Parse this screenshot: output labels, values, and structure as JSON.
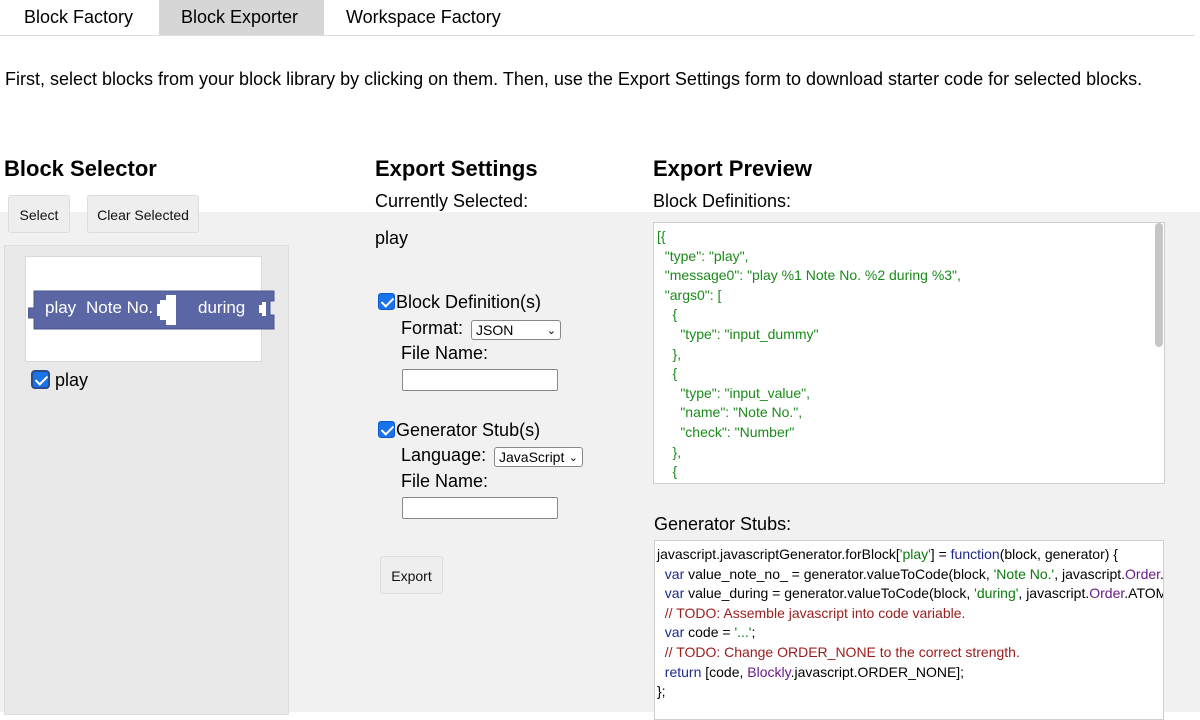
{
  "tabs": [
    "Block Factory",
    "Block Exporter",
    "Workspace Factory"
  ],
  "active_tab": "Block Exporter",
  "intro_text": "First, select blocks from your block library by clicking on them. Then, use the Export Settings form to download starter code for selected blocks.",
  "selector": {
    "title": "Block Selector",
    "select_button": "Select",
    "clear_button": "Clear Selected",
    "block": {
      "label_1": "play",
      "label_2": "Note No.",
      "label_3": "during",
      "color": "#5b67a5"
    },
    "item_label": "play",
    "item_checked": true
  },
  "export_settings": {
    "title": "Export Settings",
    "currently_selected_label": "Currently Selected:",
    "currently_selected_value": "play",
    "block_definitions": {
      "label": "Block Definition(s)",
      "checked": true,
      "format_label": "Format:",
      "format_value": "JSON",
      "file_name_label": "File Name:",
      "file_name_value": ""
    },
    "generator_stubs": {
      "label": "Generator Stub(s)",
      "checked": true,
      "language_label": "Language:",
      "language_value": "JavaScript",
      "file_name_label": "File Name:",
      "file_name_value": ""
    },
    "export_button": "Export"
  },
  "export_preview": {
    "title": "Export Preview",
    "block_definitions_label": "Block Definitions:",
    "block_definitions_lines": [
      "[{",
      "  \"type\": \"play\",",
      "  \"message0\": \"play %1 Note No. %2 during %3\",",
      "  \"args0\": [",
      "    {",
      "      \"type\": \"input_dummy\"",
      "    },",
      "    {",
      "      \"type\": \"input_value\",",
      "      \"name\": \"Note No.\",",
      "      \"check\": \"Number\"",
      "    },",
      "    {"
    ],
    "generator_stubs_label": "Generator Stubs:",
    "generator_stub_lines": [
      "javascript.javascriptGenerator.forBlock['play'] = function(block, generator) {",
      "  var value_note_no_ = generator.valueToCode(block, 'Note No.', javascript.Order.ATOMIC);",
      "  var value_during = generator.valueToCode(block, 'during', javascript.Order.ATOMIC);",
      "  // TODO: Assemble javascript into code variable.",
      "  var code = '...';",
      "  // TODO: Change ORDER_NONE to the correct strength.",
      "  return [code, Blockly.javascript.ORDER_NONE];",
      "};"
    ]
  }
}
